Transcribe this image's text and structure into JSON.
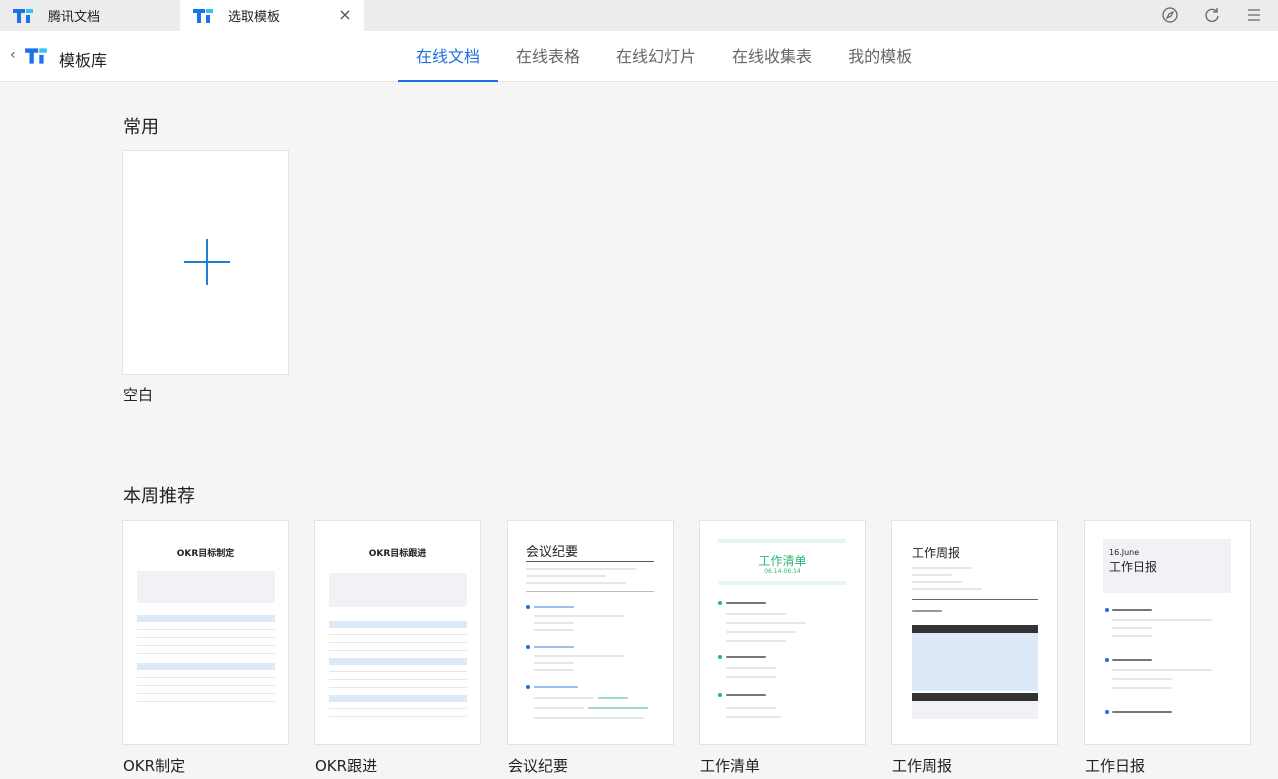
{
  "window": {
    "tabs": [
      {
        "label": "腾讯文档"
      },
      {
        "label": "选取模板"
      }
    ],
    "close_symbol": "×",
    "controls": [
      "compass-icon",
      "refresh-icon",
      "menu-icon"
    ]
  },
  "header": {
    "back_symbol": "‹",
    "title": "模板库",
    "nav": [
      {
        "label": "在线文档",
        "active": true
      },
      {
        "label": "在线表格"
      },
      {
        "label": "在线幻灯片"
      },
      {
        "label": "在线收集表"
      },
      {
        "label": "我的模板"
      }
    ]
  },
  "common": {
    "title": "常用",
    "blank_label": "空白"
  },
  "weekly": {
    "title": "本周推荐",
    "templates": [
      {
        "label": "OKR制定",
        "preview_title": "OKR目标制定"
      },
      {
        "label": "OKR跟进",
        "preview_title": "OKR目标跟进"
      },
      {
        "label": "会议纪要",
        "preview_title": "会议纪要"
      },
      {
        "label": "工作清单",
        "preview_title": "工作清单",
        "preview_sub": "06.14-06.14"
      },
      {
        "label": "工作周报",
        "preview_title": "工作周报"
      },
      {
        "label": "工作日报",
        "preview_title": "工作日报",
        "preview_date": "16.June"
      }
    ]
  },
  "colors": {
    "accent": "#1e6fd9",
    "plus": "#1e7fd6",
    "green": "#2bb673"
  }
}
